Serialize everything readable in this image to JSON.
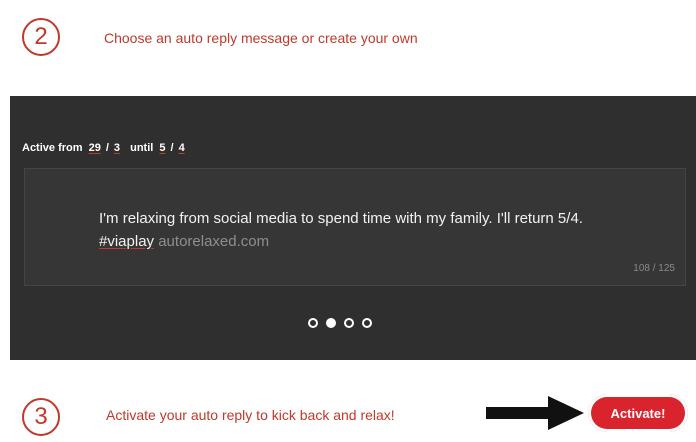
{
  "step2": {
    "number": "2",
    "text": "Choose an auto reply message or create your own"
  },
  "panel": {
    "active_label": "Active from",
    "from_day": "29",
    "from_month": "3",
    "until_label": "until",
    "until_day": "5",
    "until_month": "4",
    "separator": "/",
    "message_main": "I'm relaxing from social media to spend time with my family. I'll return 5/4. ",
    "message_hashtag": "#viaplay",
    "message_site": " autorelaxed.com",
    "counter": "108 / 125",
    "carousel": {
      "count": 4,
      "active_index": 1
    }
  },
  "step3": {
    "number": "3",
    "text": "Activate your auto reply to kick back and relax!"
  },
  "activate_button": {
    "label": "Activate!"
  },
  "colors": {
    "accent": "#c0392b",
    "button": "#d9232d",
    "panel_bg": "#2f2f2f"
  }
}
